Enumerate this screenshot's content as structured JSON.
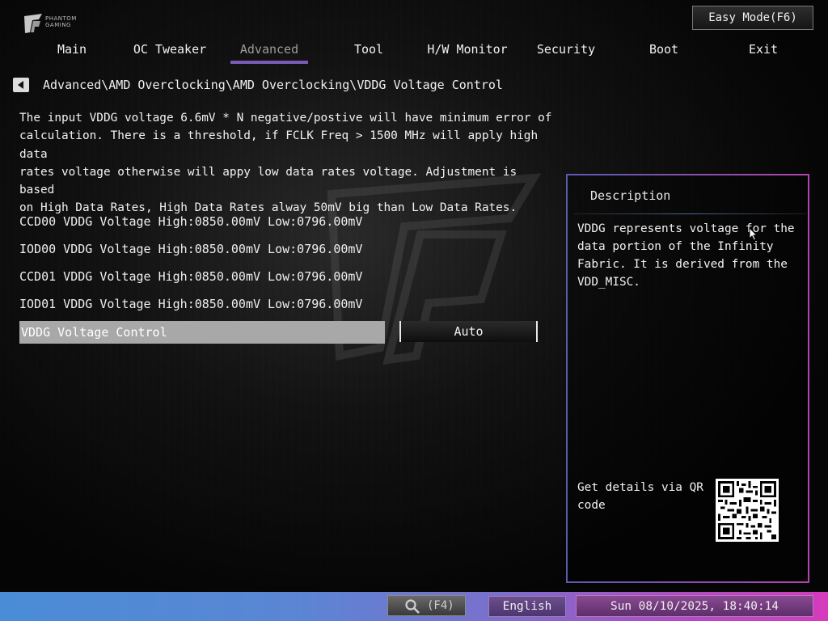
{
  "header": {
    "brand_line1": "PHANTOM",
    "brand_line2": "GAMING",
    "easy_mode_label": "Easy Mode(F6)"
  },
  "nav": {
    "tabs": [
      {
        "label": "Main"
      },
      {
        "label": "OC Tweaker"
      },
      {
        "label": "Advanced"
      },
      {
        "label": "Tool"
      },
      {
        "label": "H/W Monitor"
      },
      {
        "label": "Security"
      },
      {
        "label": "Boot"
      },
      {
        "label": "Exit"
      }
    ],
    "active_tab": "Advanced"
  },
  "breadcrumb": "Advanced\\AMD Overclocking\\AMD Overclocking\\VDDG Voltage Control",
  "intro_text": "The input VDDG voltage 6.6mV * N negative/postive will have minimum error of\ncalculation. There is a threshold, if FCLK Freq > 1500 MHz will apply high data\nrates voltage otherwise will appy low data rates voltage. Adjustment is based\non High Data Rates, High Data Rates alway 50mV big than Low Data Rates.",
  "info_lines": [
    "CCD00 VDDG Voltage High:0850.00mV Low:0796.00mV",
    "IOD00 VDDG Voltage High:0850.00mV Low:0796.00mV",
    "CCD01 VDDG Voltage High:0850.00mV Low:0796.00mV",
    "IOD01 VDDG Voltage High:0850.00mV Low:0796.00mV"
  ],
  "setting": {
    "label": "VDDG Voltage Control",
    "value": "Auto"
  },
  "description": {
    "title": "Description",
    "text": "VDDG represents voltage for the\ndata portion of the Infinity\nFabric. It is derived from the\nVDD_MISC.",
    "qr_text": "Get details via QR\ncode"
  },
  "footer": {
    "search_label": "(F4)",
    "language": "English",
    "datetime": "Sun 08/10/2025, 18:40:14"
  },
  "icons": {
    "back": "back-arrow-icon",
    "search": "search-icon",
    "qr": "qr-code-icon",
    "cursor": "mouse-cursor-icon"
  },
  "colors": {
    "nav_active_underline": "#7a5ab4",
    "selected_row": "#a8a8a8",
    "bottom_bar_start": "#4a8cd6",
    "bottom_bar_end": "#d53bbb"
  }
}
